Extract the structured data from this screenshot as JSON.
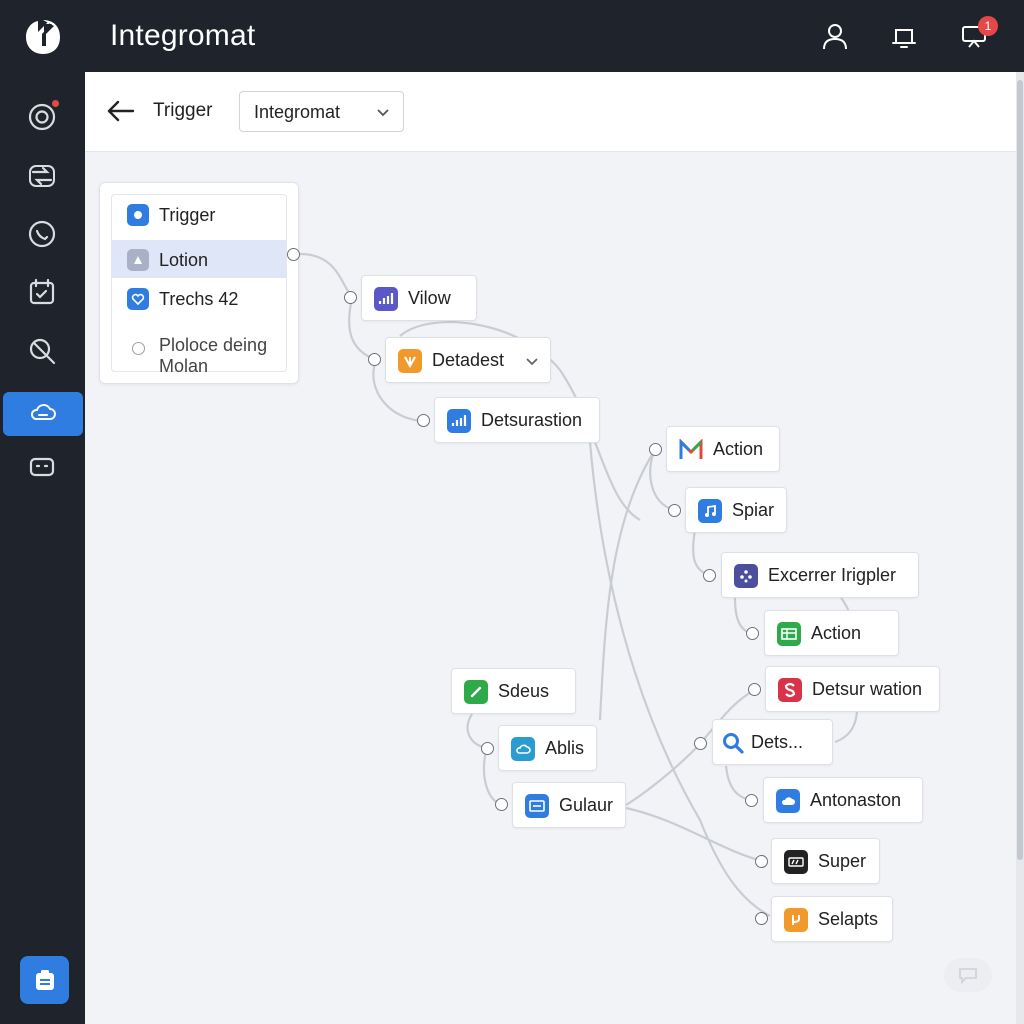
{
  "app": {
    "title": "Integromat"
  },
  "topbar": {
    "notification_count": "1"
  },
  "subheader": {
    "back_label": "Trigger",
    "select_value": "Integromat"
  },
  "panel": {
    "rows": [
      {
        "label": "Trigger",
        "icon": "module-icon"
      },
      {
        "label": "Lotion",
        "icon": "puzzle-icon"
      },
      {
        "label": "Trechs 42",
        "icon": "heart-shield-icon"
      }
    ],
    "option_text": "Ploloce deing Molan"
  },
  "nodes": [
    {
      "id": "vilow",
      "label": "Vilow",
      "icon": "bar-chart-icon",
      "color": "#5b57c7"
    },
    {
      "id": "detadest",
      "label": "Detadest",
      "icon": "tag-icon",
      "color": "#f19a2b"
    },
    {
      "id": "detsurastion",
      "label": "Detsurastion",
      "icon": "bar-chart-icon",
      "color": "#2f7de1"
    },
    {
      "id": "action1",
      "label": "Action",
      "icon": "gmail-icon",
      "color": "#e04a3a"
    },
    {
      "id": "spiar",
      "label": "Spiar",
      "icon": "music-note-icon",
      "color": "#2f7de1"
    },
    {
      "id": "excerrer",
      "label": "Excerrer Irigpler",
      "icon": "dots-icon",
      "color": "#4c4f9c"
    },
    {
      "id": "action2",
      "label": "Action",
      "icon": "sheet-icon",
      "color": "#2eaa4a"
    },
    {
      "id": "detsurwation",
      "label": "Detsur wation",
      "icon": "s-icon",
      "color": "#d8334a"
    },
    {
      "id": "dets",
      "label": "Dets...",
      "icon": "search-icon",
      "color": "#2f7de1"
    },
    {
      "id": "sdeus",
      "label": "Sdeus",
      "icon": "pen-icon",
      "color": "#2eaa4a"
    },
    {
      "id": "ablis",
      "label": "Ablis",
      "icon": "cloud-icon",
      "color": "#2a9ccf"
    },
    {
      "id": "gulaur",
      "label": "Gulaur",
      "icon": "screen-icon",
      "color": "#2f7de1"
    },
    {
      "id": "antonaston",
      "label": "Antonaston",
      "icon": "cloud-icon",
      "color": "#2f7de1"
    },
    {
      "id": "super",
      "label": "Super",
      "icon": "terminal-icon",
      "color": "#222222"
    },
    {
      "id": "selapts",
      "label": "Selapts",
      "icon": "branch-icon",
      "color": "#f19a2b"
    }
  ],
  "colors": {
    "accent": "#2f7de1",
    "rail_bg": "#1f242c",
    "canvas_bg": "#f1f3f6"
  }
}
